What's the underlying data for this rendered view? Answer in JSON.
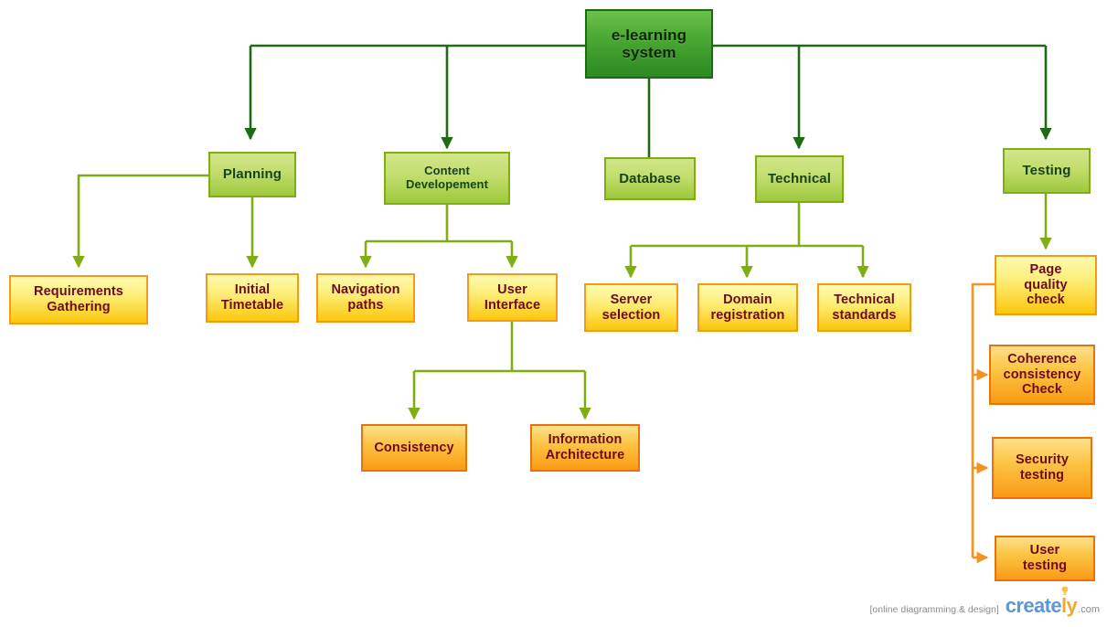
{
  "diagram": {
    "title": "e-learning system",
    "palette": {
      "root_fill_top": "#6cc24a",
      "root_fill_bottom": "#2b8a22",
      "root_border": "#1d6b12",
      "green_fill_top": "#d2e68a",
      "green_fill_bottom": "#9dc93c",
      "green_border": "#7fae13",
      "yellow_fill_top": "#fdfbb0",
      "yellow_fill_bottom": "#fcc70d",
      "yellow_border": "#f59a15",
      "orange_fill_top": "#fde08a",
      "orange_fill_bottom": "#f99b15",
      "orange_border": "#e8730c",
      "text_green": "#17431a",
      "text_maroon": "#6e0b18",
      "connector_dark_green": "#1d6b12",
      "connector_green": "#7fae13",
      "connector_orange": "#f5921e"
    },
    "nodes": {
      "root": {
        "label": "e-learning\nsystem"
      },
      "planning": {
        "label": "Planning"
      },
      "content_development": {
        "label": "Content\nDevelopement"
      },
      "database": {
        "label": "Database"
      },
      "technical": {
        "label": "Technical"
      },
      "testing": {
        "label": "Testing"
      },
      "requirements_gathering": {
        "label": "Requirements\nGathering"
      },
      "initial_timetable": {
        "label": "Initial\nTimetable"
      },
      "navigation_paths": {
        "label": "Navigation\npaths"
      },
      "user_interface": {
        "label": "User\nInterface"
      },
      "server_selection": {
        "label": "Server\nselection"
      },
      "domain_registration": {
        "label": "Domain\nregistration"
      },
      "technical_standards": {
        "label": "Technical\nstandards"
      },
      "page_quality_check": {
        "label": "Page\nquality\ncheck"
      },
      "consistency": {
        "label": "Consistency"
      },
      "information_architecture": {
        "label": "Information\nArchitecture"
      },
      "coherence_consistency_check": {
        "label": "Coherence\nconsistency\nCheck"
      },
      "security_testing": {
        "label": "Security\ntesting"
      },
      "user_testing": {
        "label": "User\ntesting"
      }
    }
  },
  "watermark": {
    "tagline": "[online diagramming & design]",
    "logo_part1": "create",
    "logo_part2": "ly",
    "dotcom": ".com"
  }
}
